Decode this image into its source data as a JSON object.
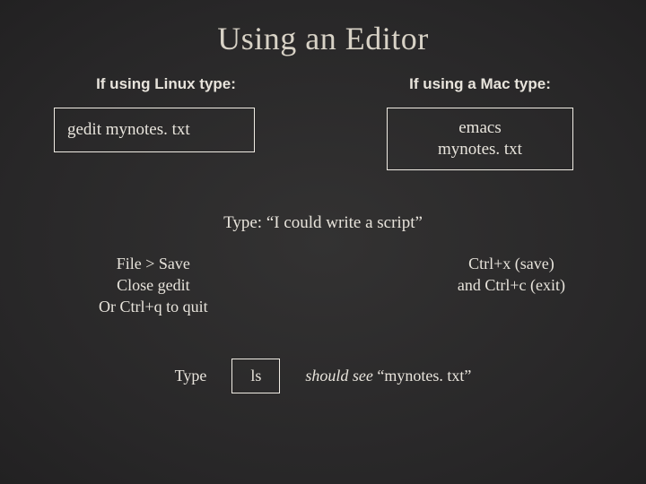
{
  "title": "Using an Editor",
  "linux": {
    "label": "If using Linux type:",
    "command": "gedit  mynotes. txt"
  },
  "mac": {
    "label": "If using a Mac type:",
    "command_line1": "emacs",
    "command_line2": "mynotes. txt"
  },
  "type_line": "Type: “I could write a script”",
  "linux_instr": {
    "l1": "File > Save",
    "l2": "Close gedit",
    "l3": "Or Ctrl+q to quit"
  },
  "mac_instr": {
    "l1": "Ctrl+x (save)",
    "l2": "and Ctrl+c (exit)"
  },
  "bottom": {
    "type_label": "Type",
    "ls_command": "ls",
    "result_italic": "should  see",
    "result_rest": "  “mynotes. txt”"
  }
}
